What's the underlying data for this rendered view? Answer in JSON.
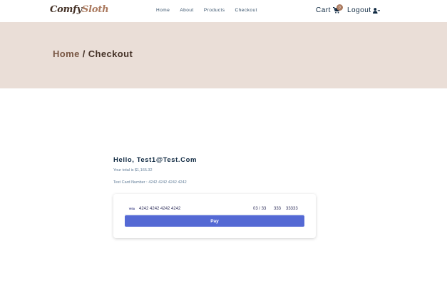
{
  "navbar": {
    "logo_part1": "Comfy",
    "logo_part2": "Sloth",
    "links": [
      "Home",
      "About",
      "Products",
      "Checkout"
    ],
    "cart_label": "Cart",
    "cart_count": "0",
    "logout_label": "Logout",
    "cart_icon": "shopping-cart-icon",
    "logout_icon": "user-minus-icon"
  },
  "hero": {
    "crumb_home": "Home",
    "crumb_sep": " / ",
    "crumb_current": "Checkout"
  },
  "checkout": {
    "greeting": "Hello, Test1@Test.Com",
    "total_text": "Your total is $1,165.32",
    "test_card_text": "Test Card Number : 4242 4242 4242 4242",
    "card": {
      "brand": "VISA",
      "number": "4242 4242 4242 4242",
      "expiry": "03 / 33",
      "cvc": "333",
      "zip": "33333"
    },
    "pay_label": "Pay"
  },
  "colors": {
    "hero_bg": "#eaded7",
    "brand_dark": "#453227",
    "brand_accent": "#ab7a5f",
    "pay_button": "#5469d4"
  }
}
